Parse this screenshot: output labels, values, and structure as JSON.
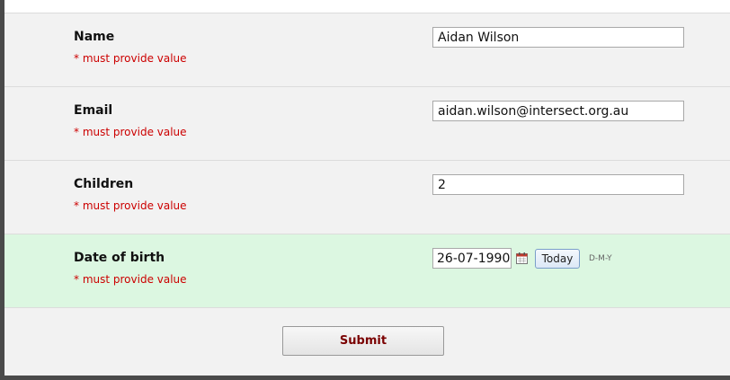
{
  "form": {
    "fields": [
      {
        "label": "Name",
        "required_text": "* must provide value",
        "value": "Aidan Wilson"
      },
      {
        "label": "Email",
        "required_text": "* must provide value",
        "value": "aidan.wilson@intersect.org.au"
      },
      {
        "label": "Children",
        "required_text": "* must provide value",
        "value": "2"
      },
      {
        "label": "Date of birth",
        "required_text": "* must provide value",
        "value": "26-07-1990",
        "today_label": "Today",
        "format_hint": "D-M-Y",
        "calendar_icon": "calendar-icon"
      }
    ],
    "submit_label": "Submit"
  },
  "colors": {
    "required": "#cc0000",
    "highlight_row": "#dcf7e1",
    "submit_text": "#7a0000",
    "page_background": "#f2f2f2"
  }
}
